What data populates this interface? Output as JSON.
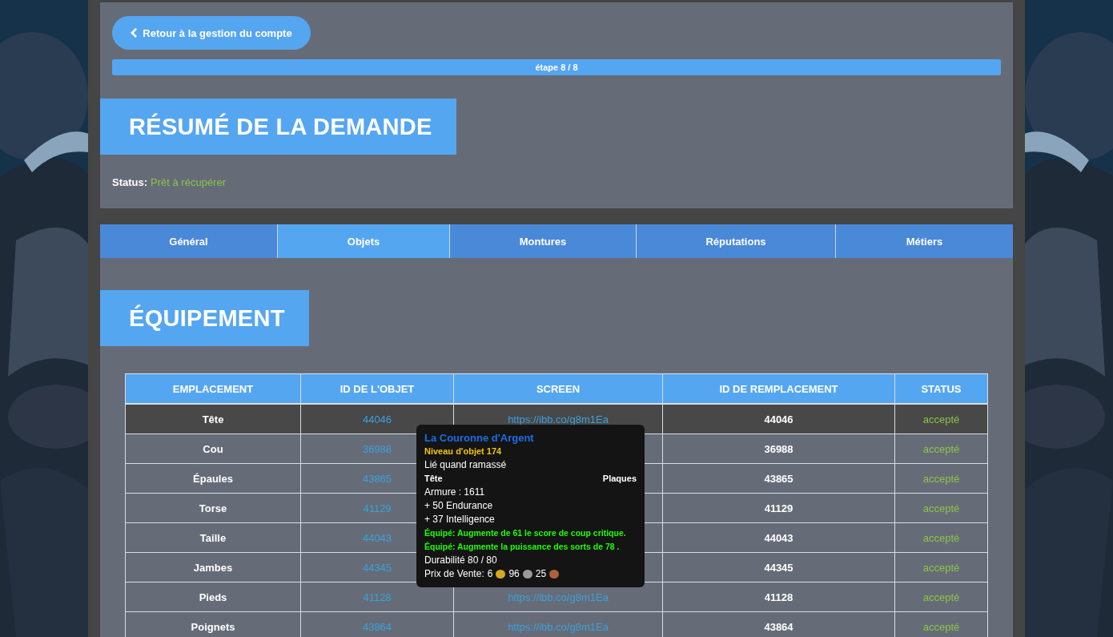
{
  "back_button": {
    "label": "Retour à la gestion du compte"
  },
  "progress": {
    "label": "étape 8 / 8",
    "level": 1
  },
  "summary": {
    "title": "RÉSUMÉ DE LA DEMANDE",
    "status_label": "Status:",
    "status_value": "Prêt à récupérer"
  },
  "tabs": [
    {
      "label": "Général",
      "selected": false
    },
    {
      "label": "Objets",
      "selected": true
    },
    {
      "label": "Montures",
      "selected": false
    },
    {
      "label": "Réputations",
      "selected": false
    },
    {
      "label": "Métiers",
      "selected": false
    }
  ],
  "section_title": "ÉQUIPEMENT",
  "table": {
    "columns": [
      "EMPLACEMENT",
      "ID DE L'OBJET",
      "SCREEN",
      "ID DE REMPLACEMENT",
      "STATUS"
    ],
    "rows": [
      {
        "slot": "Tête",
        "item_id": "44046",
        "screen": "https://ibb.co/g8m1Ea",
        "replacement_id": "44046",
        "status": "accepté",
        "selected": true
      },
      {
        "slot": "Cou",
        "item_id": "36988",
        "replacement_id": "36988",
        "status": "accepté",
        "selected": false
      },
      {
        "slot": "Épaules",
        "item_id": "43865",
        "replacement_id": "43865",
        "status": "accepté",
        "selected": false
      },
      {
        "slot": "Torse",
        "item_id": "41129",
        "replacement_id": "41129",
        "status": "accepté",
        "selected": false
      },
      {
        "slot": "Taille",
        "item_id": "44043",
        "replacement_id": "44043",
        "status": "accepté",
        "selected": false
      },
      {
        "slot": "Jambes",
        "item_id": "44345",
        "replacement_id": "44345",
        "status": "accepté",
        "selected": false
      },
      {
        "slot": "Pieds",
        "item_id": "41128",
        "screen": "https://ibb.co/g8m1Ea",
        "replacement_id": "41128",
        "status": "accepté",
        "selected": false
      },
      {
        "slot": "Poignets",
        "item_id": "43864",
        "screen": "https://ibb.co/g8m1Ea",
        "replacement_id": "43864",
        "status": "accepté",
        "selected": false
      }
    ]
  },
  "tooltip": {
    "lines": [
      {
        "kind": "name",
        "text": "La Couronne d'Argent"
      },
      {
        "kind": "level",
        "text": "Niveau d'objet 174"
      },
      {
        "kind": "plain",
        "text": "Lié quand ramassé"
      },
      {
        "kind": "split",
        "left": "Tête",
        "right": "Plaques"
      },
      {
        "kind": "plain",
        "text": "Armure : 1611"
      },
      {
        "kind": "plain",
        "text": "+ 50 Endurance"
      },
      {
        "kind": "plain",
        "text": "+ 37 Intelligence"
      },
      {
        "kind": "effect",
        "text": "Équipé: Augmente de 61 le score de coup critique."
      },
      {
        "kind": "effect",
        "text": "Équipé: Augmente la puissance des sorts de 78 ."
      },
      {
        "kind": "plain",
        "text": "Durabilité 80 / 80"
      }
    ],
    "price": {
      "label": "Prix de Vente:",
      "gold": "6",
      "silver": "96",
      "copper": "25"
    }
  }
}
